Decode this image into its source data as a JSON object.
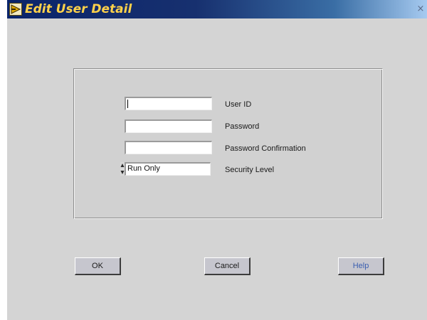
{
  "window": {
    "title": "Edit User Detail",
    "close_glyph": "×"
  },
  "form": {
    "user_id": {
      "label": "User ID",
      "value": ""
    },
    "password": {
      "label": "Password",
      "value": ""
    },
    "password_confirmation": {
      "label": "Password Confirmation",
      "value": ""
    },
    "security_level": {
      "label": "Security Level",
      "value": "Run Only"
    }
  },
  "buttons": {
    "ok": "OK",
    "cancel": "Cancel",
    "help": "Help"
  },
  "icons": {
    "app": "labview-app-icon",
    "close": "close-icon",
    "spin": "spin-arrows-icon"
  },
  "colors": {
    "title_text": "#ffd24a",
    "title_bar": "#17306f",
    "background": "#d4d4d4",
    "help_text": "#3b5fb0"
  }
}
